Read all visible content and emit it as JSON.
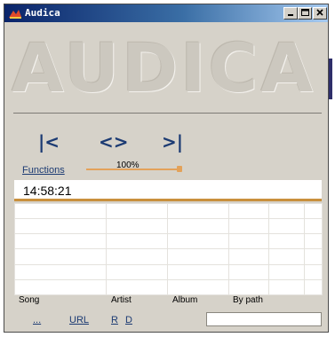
{
  "window": {
    "title": "Audica"
  },
  "titlebar": {
    "minimize": "_",
    "maximize": "□",
    "close": "✕"
  },
  "logo": {
    "text": "AUDICA"
  },
  "controls": {
    "prev": "|<",
    "play": "<>",
    "next": ">|"
  },
  "functions_link": "Functions",
  "volume": {
    "label": "100%",
    "level": 1.0
  },
  "time": {
    "display": "14:58:21"
  },
  "playlist": {
    "columns": [
      "Song",
      "Artist",
      "Album",
      "By path"
    ],
    "rows": 6
  },
  "bottom_links": {
    "more": "...",
    "url": "URL",
    "r": "R",
    "d": "D"
  },
  "url_input": {
    "value": ""
  },
  "colors": {
    "accent": "#e3a25a",
    "link": "#1c3b73",
    "background": "#d6d2c9"
  }
}
